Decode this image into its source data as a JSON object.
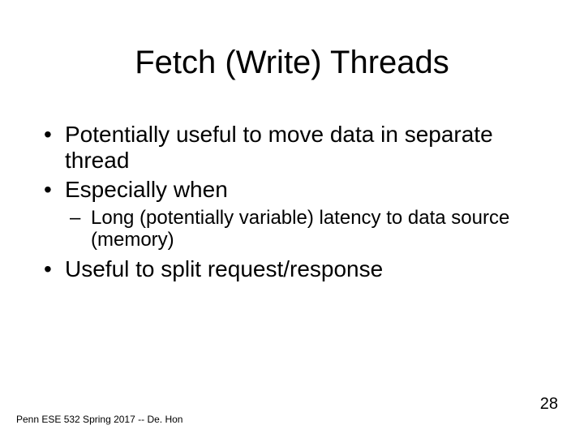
{
  "title": "Fetch (Write) Threads",
  "bullets": {
    "b1": "Potentially useful to move data in separate thread",
    "b2": "Especially when",
    "b2s1": "Long (potentially variable) latency to data source (memory)",
    "b3": "Useful to split request/response"
  },
  "footer": "Penn ESE 532 Spring 2017 -- De. Hon",
  "page": "28"
}
